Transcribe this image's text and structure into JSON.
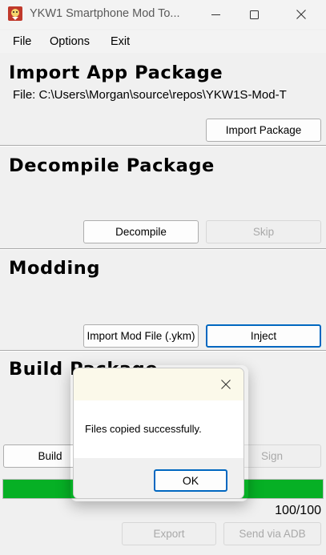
{
  "window": {
    "title": "YKW1 Smartphone Mod To...",
    "icon": "app-icon",
    "controls": [
      "minimize-icon",
      "maximize-icon",
      "close-icon"
    ]
  },
  "menu": {
    "file": "File",
    "options": "Options",
    "exit": "Exit"
  },
  "import_section": {
    "title": "Import App Package",
    "file_label": "File:",
    "file_path": "C:\\Users\\Morgan\\source\\repos\\YKW1S-Mod-T",
    "import_button": "Import Package"
  },
  "decompile_section": {
    "title": "Decompile Package",
    "decompile_button": "Decompile",
    "skip_button": "Skip"
  },
  "modding_section": {
    "title": "Modding",
    "import_mod_button": "Import Mod File (.ykm)",
    "inject_button": "Inject"
  },
  "build_section": {
    "title": "Build Package",
    "build_button": "Build",
    "sign_button": "Sign"
  },
  "progress": {
    "value": 100,
    "max": 100,
    "text": "100/100",
    "color": "#06b025"
  },
  "footer": {
    "export_button": "Export",
    "send_button": "Send via ADB"
  },
  "dialog": {
    "message": "Files copied successfully.",
    "ok_button": "OK"
  },
  "colors": {
    "accent": "#0067c0",
    "dialog_header": "#fbf9ea",
    "progress_fill": "#06b025"
  }
}
